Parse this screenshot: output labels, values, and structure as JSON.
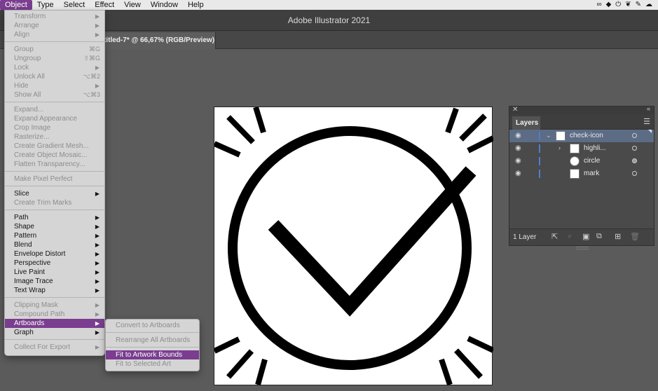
{
  "menubar": {
    "items": [
      "Object",
      "Type",
      "Select",
      "Effect",
      "View",
      "Window",
      "Help"
    ],
    "tray_icons": [
      "creative-cloud-icon",
      "dropbox-icon",
      "power-icon",
      "feather-icon",
      "pen-icon",
      "cloud-icon"
    ]
  },
  "window": {
    "title": "Adobe Illustrator 2021"
  },
  "document_tab": {
    "label": "titled-7* @ 66,67% (RGB/Preview)"
  },
  "object_menu": {
    "items": [
      {
        "label": "Transform",
        "disabled": true,
        "submenu": true
      },
      {
        "label": "Arrange",
        "disabled": true,
        "submenu": true
      },
      {
        "label": "Align",
        "disabled": true,
        "submenu": true
      },
      {
        "separator": true
      },
      {
        "label": "Group",
        "disabled": true,
        "shortcut": "⌘G"
      },
      {
        "label": "Ungroup",
        "disabled": true,
        "shortcut": "⇧⌘G"
      },
      {
        "label": "Lock",
        "disabled": true,
        "submenu": true
      },
      {
        "label": "Unlock All",
        "disabled": true,
        "shortcut": "⌥⌘2"
      },
      {
        "label": "Hide",
        "disabled": true,
        "submenu": true
      },
      {
        "label": "Show All",
        "disabled": true,
        "shortcut": "⌥⌘3"
      },
      {
        "separator": true
      },
      {
        "label": "Expand...",
        "disabled": true
      },
      {
        "label": "Expand Appearance",
        "disabled": true
      },
      {
        "label": "Crop Image",
        "disabled": true
      },
      {
        "label": "Rasterize...",
        "disabled": true
      },
      {
        "label": "Create Gradient Mesh...",
        "disabled": true
      },
      {
        "label": "Create Object Mosaic...",
        "disabled": true
      },
      {
        "label": "Flatten Transparency...",
        "disabled": true
      },
      {
        "separator": true
      },
      {
        "label": "Make Pixel Perfect",
        "disabled": true
      },
      {
        "separator": true
      },
      {
        "label": "Slice",
        "disabled": false,
        "submenu": true
      },
      {
        "label": "Create Trim Marks",
        "disabled": true
      },
      {
        "separator": true
      },
      {
        "label": "Path",
        "disabled": false,
        "submenu": true
      },
      {
        "label": "Shape",
        "disabled": false,
        "submenu": true
      },
      {
        "label": "Pattern",
        "disabled": false,
        "submenu": true
      },
      {
        "label": "Blend",
        "disabled": false,
        "submenu": true
      },
      {
        "label": "Envelope Distort",
        "disabled": false,
        "submenu": true
      },
      {
        "label": "Perspective",
        "disabled": false,
        "submenu": true
      },
      {
        "label": "Live Paint",
        "disabled": false,
        "submenu": true
      },
      {
        "label": "Image Trace",
        "disabled": false,
        "submenu": true
      },
      {
        "label": "Text Wrap",
        "disabled": false,
        "submenu": true
      },
      {
        "separator": true
      },
      {
        "label": "Clipping Mask",
        "disabled": true,
        "submenu": true
      },
      {
        "label": "Compound Path",
        "disabled": true,
        "submenu": true
      },
      {
        "label": "Artboards",
        "disabled": false,
        "submenu": true,
        "highlighted": true
      },
      {
        "label": "Graph",
        "disabled": false,
        "submenu": true
      },
      {
        "separator": true
      },
      {
        "label": "Collect For Export",
        "disabled": true,
        "submenu": true
      }
    ]
  },
  "artboards_submenu": {
    "items": [
      {
        "label": "Convert to Artboards",
        "disabled": true
      },
      {
        "separator": true
      },
      {
        "label": "Rearrange All Artboards",
        "disabled": true
      },
      {
        "separator": true
      },
      {
        "label": "Fit to Artwork Bounds",
        "disabled": false,
        "highlighted": true
      },
      {
        "label": "Fit to Selected Art",
        "disabled": true
      }
    ]
  },
  "layers_panel": {
    "tab": "Layers",
    "rows": [
      {
        "name": "check-icon",
        "level": 0,
        "expanded": true,
        "selected": true,
        "target_filled": false
      },
      {
        "name": "highli...",
        "level": 1,
        "expanded": false,
        "selected": false,
        "target_filled": false
      },
      {
        "name": "circle",
        "level": 1,
        "selected": false,
        "target_filled": true
      },
      {
        "name": "mark",
        "level": 1,
        "selected": false,
        "target_filled": false
      }
    ],
    "footer_count": "1 Layer"
  }
}
